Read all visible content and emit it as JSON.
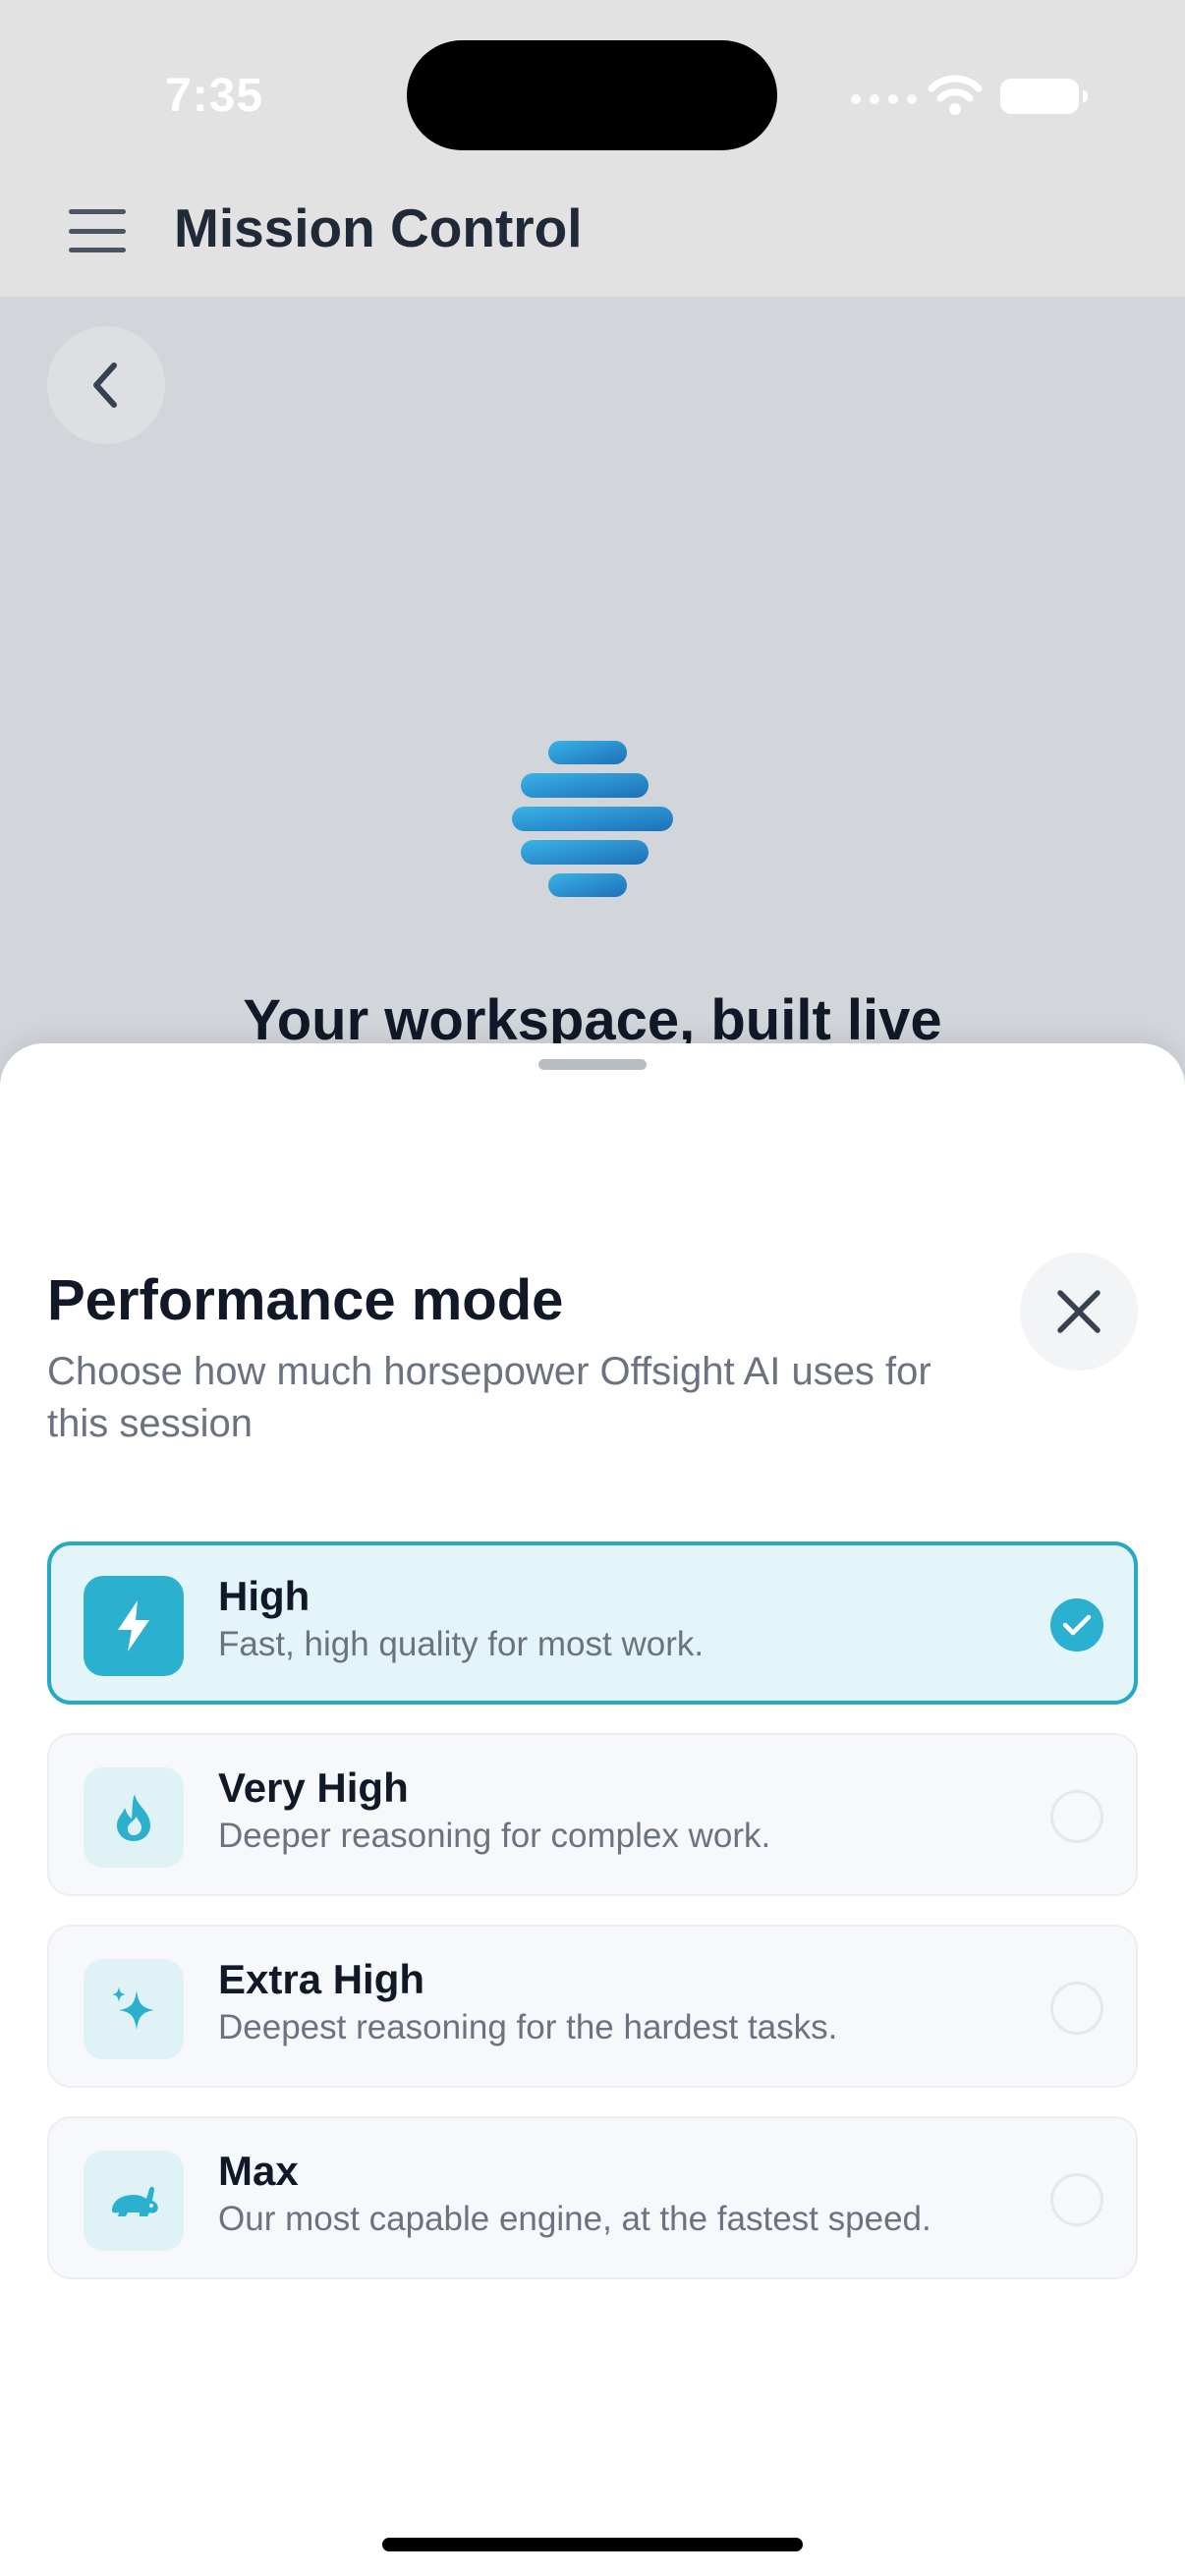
{
  "status_bar": {
    "time": "7:35"
  },
  "app_bar": {
    "title": "Mission Control",
    "menu_icon": "hamburger-menu-icon"
  },
  "background": {
    "back_icon": "chevron-left-icon",
    "logo_icon": "striped-orb-logo",
    "hero_text": "Your workspace, built live"
  },
  "sheet": {
    "title": "Performance mode",
    "subtitle": "Choose how much horsepower Offsight AI uses for this session",
    "close_icon": "close-icon",
    "options": [
      {
        "label": "High",
        "description": "Fast, high quality for most work.",
        "icon": "lightning-icon",
        "selected": true
      },
      {
        "label": "Very High",
        "description": "Deeper reasoning for complex work.",
        "icon": "flame-icon",
        "selected": false
      },
      {
        "label": "Extra High",
        "description": "Deepest reasoning for the hardest tasks.",
        "icon": "sparkle-icon",
        "selected": false
      },
      {
        "label": "Max",
        "description": "Our most capable engine, at the fastest speed.",
        "icon": "rabbit-icon",
        "selected": false
      }
    ]
  },
  "colors": {
    "accent": "#2bb0cf",
    "selected_bg": "#e3f5f9",
    "title_text": "#111827",
    "muted_text": "#6b7280"
  }
}
